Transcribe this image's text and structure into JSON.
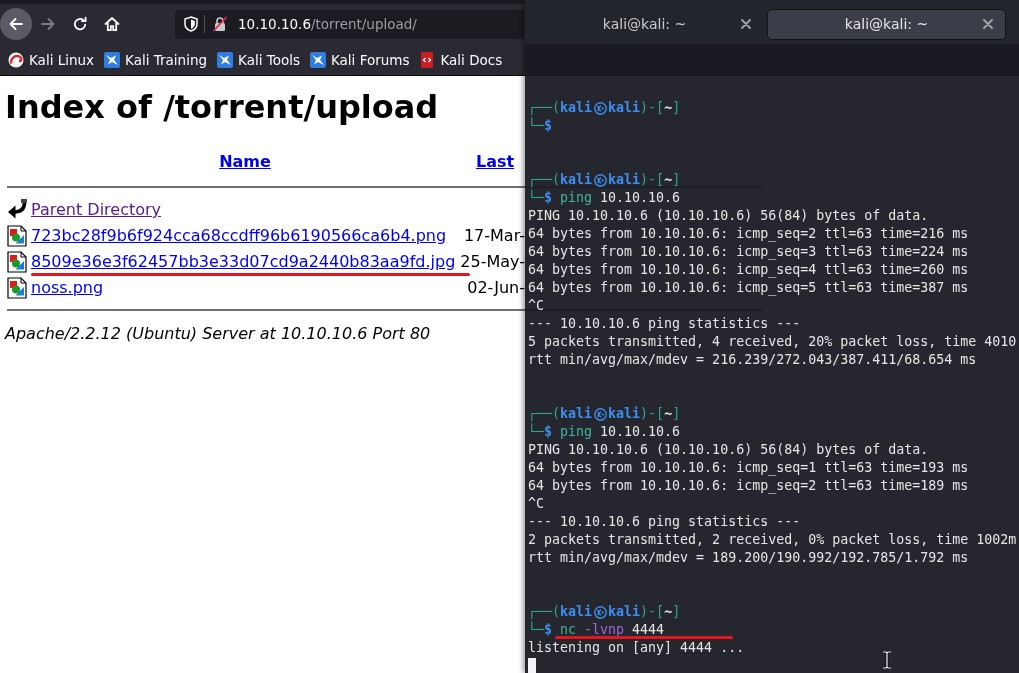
{
  "browser": {
    "navigation": [
      {
        "kind": "back",
        "disabled": false,
        "hovered": true
      },
      {
        "kind": "forward",
        "disabled": true,
        "hovered": false
      },
      {
        "kind": "reload",
        "disabled": false,
        "hovered": false
      },
      {
        "kind": "home",
        "disabled": false,
        "hovered": false
      }
    ],
    "address": {
      "host": "10.10.10.6",
      "path": "/torrent/upload/",
      "secure": false
    },
    "bookmarks": [
      {
        "label": "Kali Linux",
        "kind": "kali"
      },
      {
        "label": "Kali Training",
        "kind": "dragon"
      },
      {
        "label": "Kali Tools",
        "kind": "dragon"
      },
      {
        "label": "Kali Forums",
        "kind": "dragon"
      },
      {
        "label": "Kali Docs",
        "kind": "docs"
      }
    ]
  },
  "page": {
    "title": "Index of /torrent/upload",
    "columns": [
      "Name",
      "Last"
    ],
    "rows": [
      {
        "kind": "parent",
        "name": "Parent Directory",
        "visited": true,
        "highlighted": false
      },
      {
        "kind": "image",
        "name": "723bc28f9b6f924cca68ccdff96b6190566ca6b4.png",
        "modified": "17-Mar-",
        "visited": false,
        "highlighted": false
      },
      {
        "kind": "image",
        "name": "8509e36e3f62457bb3e33d07cd9a2440b83aa9fd.jpg",
        "modified": "25-May-",
        "visited": false,
        "highlighted": true
      },
      {
        "kind": "image",
        "name": "noss.png",
        "modified": "02-Jun-",
        "visited": false,
        "highlighted": false
      }
    ],
    "address": "Apache/2.2.12 (Ubuntu) Server at 10.10.10.6 Port 80"
  },
  "terminal": {
    "tabs": [
      {
        "label": "kali@kali: ~",
        "selected": false
      },
      {
        "label": "kali@kali: ~",
        "selected": true
      }
    ],
    "sessions": [
      {
        "prompt": [
          {
            "kind": "frame",
            "text": "┌──("
          },
          {
            "kind": "user",
            "text": "kali"
          },
          {
            "kind": "symbol"
          },
          {
            "kind": "user",
            "text": "kali"
          },
          {
            "kind": "frame",
            "text": ")-["
          },
          {
            "kind": "cwd",
            "text": "~"
          },
          {
            "kind": "frame",
            "text": "]"
          }
        ],
        "input": [
          {
            "kind": "frame",
            "text": "└─"
          },
          {
            "kind": "sign",
            "text": "$"
          }
        ],
        "highlighted": false
      },
      {
        "prompt": [
          {
            "kind": "frame",
            "text": "┌──("
          },
          {
            "kind": "user",
            "text": "kali"
          },
          {
            "kind": "symbol"
          },
          {
            "kind": "user",
            "text": "kali"
          },
          {
            "kind": "frame",
            "text": ")-["
          },
          {
            "kind": "cwd",
            "text": "~"
          },
          {
            "kind": "frame",
            "text": "]"
          }
        ],
        "input": [
          {
            "kind": "frame",
            "text": "└─"
          },
          {
            "kind": "sign",
            "text": "$"
          },
          {
            "kind": "program",
            "text": "ping"
          },
          {
            "kind": "argument",
            "text": "10.10.10.6"
          }
        ],
        "highlighted": false,
        "output": [
          "PING 10.10.10.6 (10.10.10.6) 56(84) bytes of data.",
          "64 bytes from 10.10.10.6: icmp_seq=2 ttl=63 time=216 ms",
          "64 bytes from 10.10.10.6: icmp_seq=3 ttl=63 time=224 ms",
          "64 bytes from 10.10.10.6: icmp_seq=4 ttl=63 time=260 ms",
          "64 bytes from 10.10.10.6: icmp_seq=5 ttl=63 time=387 ms",
          "^C",
          "--- 10.10.10.6 ping statistics ---",
          "5 packets transmitted, 4 received, 20% packet loss, time 4010",
          "rtt min/avg/max/mdev = 216.239/272.043/387.411/68.654 ms"
        ]
      },
      {
        "prompt": [
          {
            "kind": "frame",
            "text": "┌──("
          },
          {
            "kind": "user",
            "text": "kali"
          },
          {
            "kind": "symbol"
          },
          {
            "kind": "user",
            "text": "kali"
          },
          {
            "kind": "frame",
            "text": ")-["
          },
          {
            "kind": "cwd",
            "text": "~"
          },
          {
            "kind": "frame",
            "text": "]"
          }
        ],
        "input": [
          {
            "kind": "frame",
            "text": "└─"
          },
          {
            "kind": "sign",
            "text": "$"
          },
          {
            "kind": "program",
            "text": "ping"
          },
          {
            "kind": "argument",
            "text": "10.10.10.6"
          }
        ],
        "highlighted": false,
        "output": [
          "PING 10.10.10.6 (10.10.10.6) 56(84) bytes of data.",
          "64 bytes from 10.10.10.6: icmp_seq=1 ttl=63 time=193 ms",
          "64 bytes from 10.10.10.6: icmp_seq=2 ttl=63 time=189 ms",
          "^C",
          "--- 10.10.10.6 ping statistics ---",
          "2 packets transmitted, 2 received, 0% packet loss, time 1002m",
          "rtt min/avg/max/mdev = 189.200/190.992/192.785/1.792 ms"
        ]
      },
      {
        "prompt": [
          {
            "kind": "frame",
            "text": "┌──("
          },
          {
            "kind": "user",
            "text": "kali"
          },
          {
            "kind": "symbol"
          },
          {
            "kind": "user",
            "text": "kali"
          },
          {
            "kind": "frame",
            "text": ")-["
          },
          {
            "kind": "cwd",
            "text": "~"
          },
          {
            "kind": "frame",
            "text": "]"
          }
        ],
        "input": [
          {
            "kind": "frame",
            "text": "└─"
          },
          {
            "kind": "sign",
            "text": "$"
          },
          {
            "kind": "program",
            "text": "nc"
          },
          {
            "kind": "option",
            "text": "-lvnp"
          },
          {
            "kind": "argument",
            "text": "4444"
          }
        ],
        "highlighted": true,
        "output": [
          "listening on [any] 4444 ..."
        ]
      }
    ]
  }
}
